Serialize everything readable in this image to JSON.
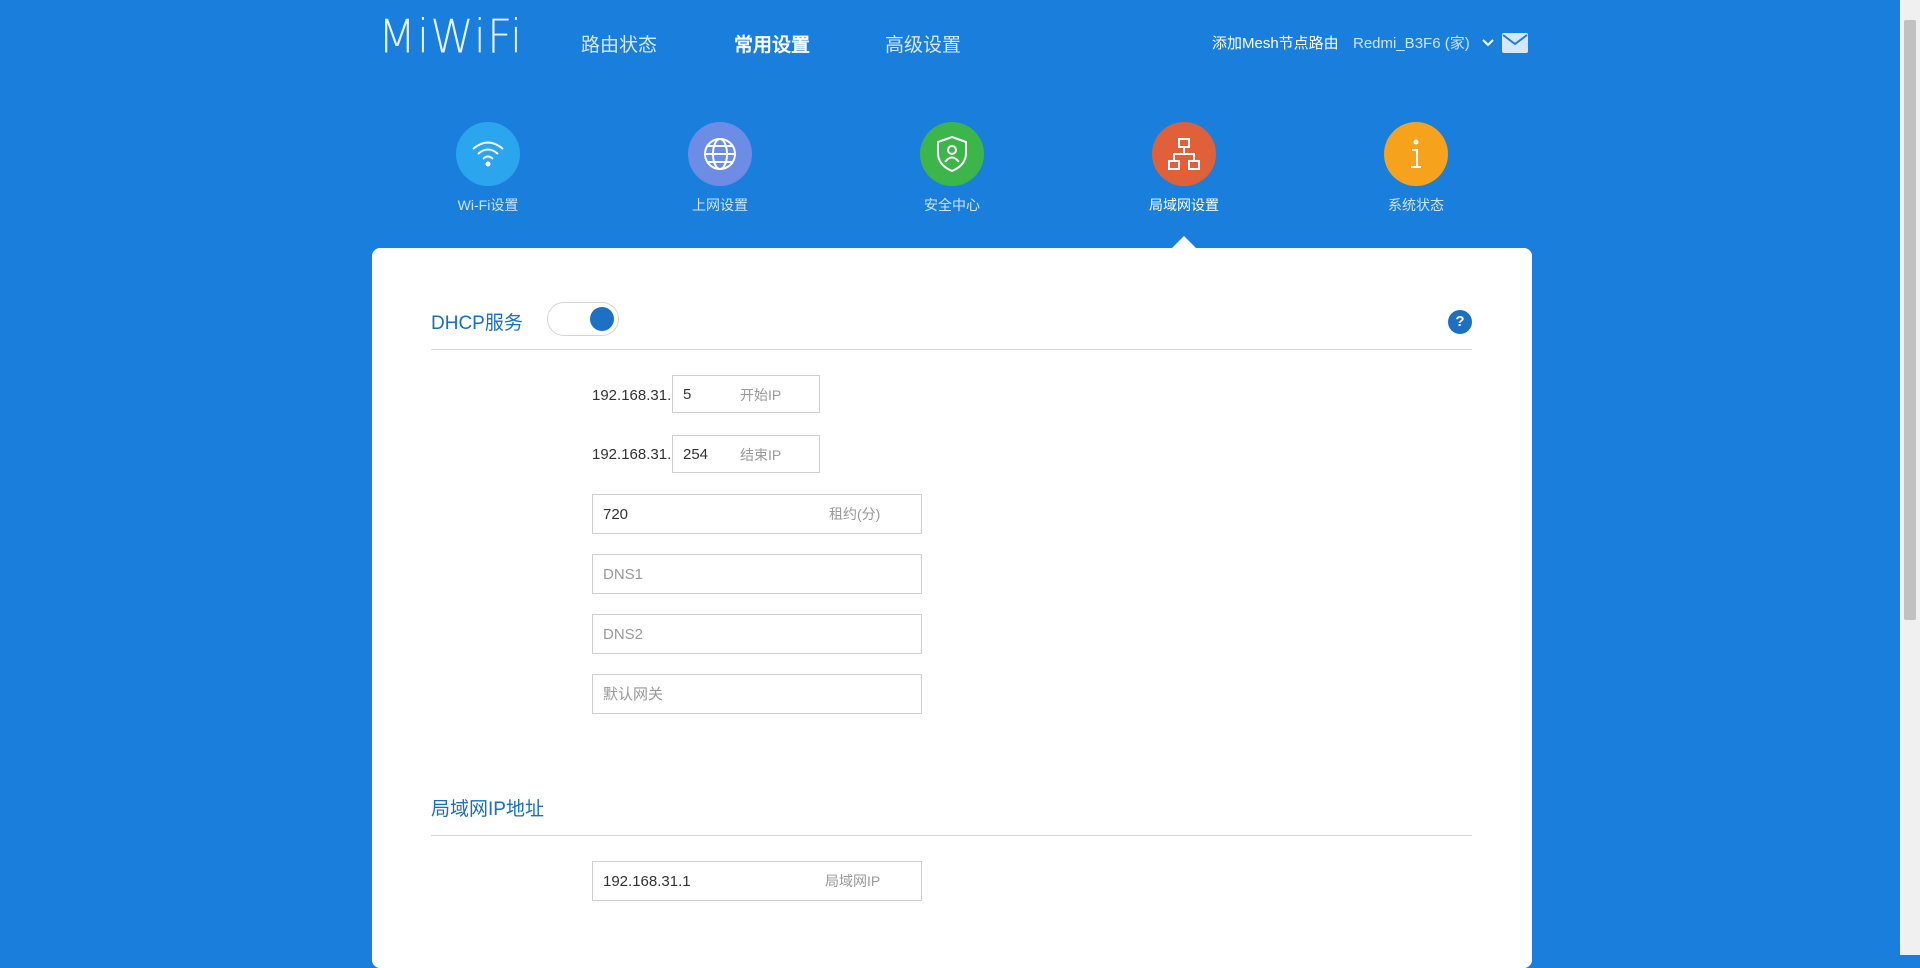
{
  "header": {
    "logo": "MiWiFi",
    "nav": [
      "路由状态",
      "常用设置",
      "高级设置"
    ],
    "active_nav": "常用设置",
    "mesh_link": "添加Mesh节点路由",
    "router_name": "Redmi_B3F6 (家)"
  },
  "icon_nav": [
    {
      "label": "Wi-Fi设置",
      "icon": "wifi-icon",
      "color": "#2aa5ee"
    },
    {
      "label": "上网设置",
      "icon": "globe-icon",
      "color": "#6c8ce6"
    },
    {
      "label": "安全中心",
      "icon": "shield-icon",
      "color": "#3cb54a"
    },
    {
      "label": "局域网设置",
      "icon": "lan-icon",
      "color": "#e0603a"
    },
    {
      "label": "系统状态",
      "icon": "info-icon",
      "color": "#f7a21d"
    }
  ],
  "active_icon_nav": "局域网设置",
  "dhcp": {
    "title": "DHCP服务",
    "enabled": true,
    "help": "?",
    "ip_prefix": "192.168.31.",
    "start_ip": {
      "value": "5",
      "label": "开始IP"
    },
    "end_ip": {
      "value": "254",
      "label": "结束IP"
    },
    "lease": {
      "value": "720",
      "label": "租约(分)"
    },
    "dns1_placeholder": "DNS1",
    "dns2_placeholder": "DNS2",
    "gateway_placeholder": "默认网关"
  },
  "lan": {
    "title": "局域网IP地址",
    "ip": {
      "value": "192.168.31.1",
      "label": "局域网IP"
    }
  }
}
